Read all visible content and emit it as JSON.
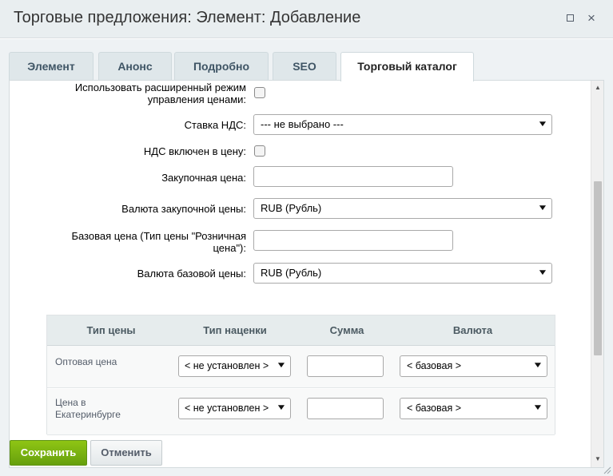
{
  "window": {
    "title": "Торговые предложения: Элемент: Добавление",
    "maximize_icon": "square-icon",
    "close_icon": "×"
  },
  "tabs": [
    {
      "label": "Элемент",
      "active": false
    },
    {
      "label": "Анонс",
      "active": false
    },
    {
      "label": "Подробно",
      "active": false
    },
    {
      "label": "SEO",
      "active": false
    },
    {
      "label": "Торговый каталог",
      "active": true
    }
  ],
  "form": {
    "extended_price_mode": {
      "label": "Использовать расширенный режим управления ценами:",
      "line1": "Использовать расширенный режим",
      "line2": "управления ценами:",
      "checked": false
    },
    "vat_rate": {
      "label": "Ставка НДС:",
      "value": "--- не выбрано ---"
    },
    "vat_included": {
      "label": "НДС включен в цену:",
      "checked": false
    },
    "purchase_price": {
      "label": "Закупочная цена:",
      "value": ""
    },
    "purchase_currency": {
      "label": "Валюта закупочной цены:",
      "value": "RUB (Рубль)"
    },
    "base_price": {
      "line1": "Базовая цена (Тип цены \"Розничная",
      "line2": "цена\"):",
      "value": ""
    },
    "base_currency": {
      "label": "Валюта базовой цены:",
      "value": "RUB (Рубль)"
    }
  },
  "price_table": {
    "headers": [
      "Тип цены",
      "Тип наценки",
      "Сумма",
      "Валюта"
    ],
    "rows": [
      {
        "name_line1": "Оптовая цена",
        "name_line2": "",
        "markup": "< не установлен >",
        "sum": "",
        "currency": "< базовая >"
      },
      {
        "name_line1": "Цена в",
        "name_line2": "Екатеринбурге",
        "markup": "< не установлен >",
        "sum": "",
        "currency": "< базовая >"
      }
    ]
  },
  "footer": {
    "save_label": "Сохранить",
    "cancel_label": "Отменить"
  },
  "colors": {
    "save_button": "#7cb40f",
    "titlebar": "#e9eef0",
    "tab_text": "#3f5565"
  }
}
